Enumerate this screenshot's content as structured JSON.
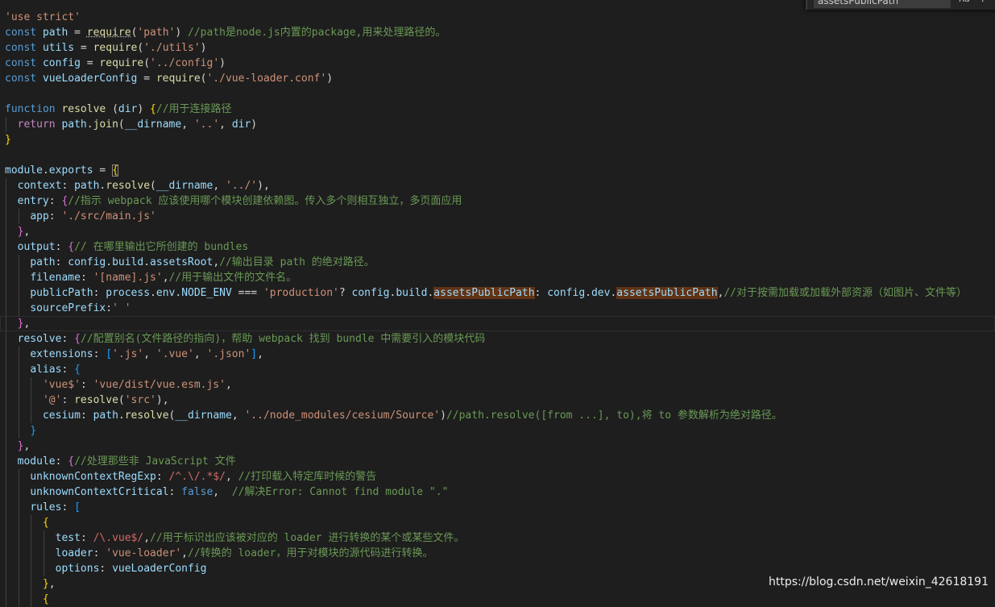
{
  "colors": {
    "background": "#1e1e1e",
    "keyword": "#569cd6",
    "control_keyword": "#c586c0",
    "string": "#ce9178",
    "variable": "#9cdcfe",
    "function": "#dcdcaa",
    "comment": "#6a9955",
    "regex": "#d16969",
    "bracket_1": "#ffd700",
    "bracket_2": "#da70d6",
    "bracket_3": "#179fff",
    "find_highlight": "#613214"
  },
  "find_widget": {
    "search_value": "assetsPublicPath",
    "icons": [
      "case-sensitive-icon",
      "regex-icon"
    ]
  },
  "watermark": "https://blog.csdn.net/weixin_42618191",
  "code_lines": [
    [
      [
        "str",
        "'use strict'"
      ]
    ],
    [
      [
        "kw",
        "const"
      ],
      [
        "pl",
        " "
      ],
      [
        "var",
        "path"
      ],
      [
        "pl",
        " = "
      ],
      [
        "fn sq",
        "require"
      ],
      [
        "pl",
        "("
      ],
      [
        "str",
        "'path'"
      ],
      [
        "pl",
        ") "
      ],
      [
        "cmt",
        "//path是node.js内置的package,用来处理路径的。"
      ]
    ],
    [
      [
        "kw",
        "const"
      ],
      [
        "pl",
        " "
      ],
      [
        "var",
        "utils"
      ],
      [
        "pl",
        " = "
      ],
      [
        "fn",
        "require"
      ],
      [
        "pl",
        "("
      ],
      [
        "str",
        "'./utils'"
      ],
      [
        "pl",
        ")"
      ]
    ],
    [
      [
        "kw",
        "const"
      ],
      [
        "pl",
        " "
      ],
      [
        "var",
        "config"
      ],
      [
        "pl",
        " = "
      ],
      [
        "fn",
        "require"
      ],
      [
        "pl",
        "("
      ],
      [
        "str",
        "'../config'"
      ],
      [
        "pl",
        ")"
      ]
    ],
    [
      [
        "kw",
        "const"
      ],
      [
        "pl",
        " "
      ],
      [
        "var",
        "vueLoaderConfig"
      ],
      [
        "pl",
        " = "
      ],
      [
        "fn",
        "require"
      ],
      [
        "pl",
        "("
      ],
      [
        "str",
        "'./vue-loader.conf'"
      ],
      [
        "pl",
        ")"
      ]
    ],
    [],
    [
      [
        "kw",
        "function"
      ],
      [
        "pl",
        " "
      ],
      [
        "fn",
        "resolve"
      ],
      [
        "pl",
        " ("
      ],
      [
        "var",
        "dir"
      ],
      [
        "pl",
        ") "
      ],
      [
        "br",
        "{"
      ],
      [
        "cmt",
        "//用于连接路径"
      ]
    ],
    [
      [
        "pl",
        "  "
      ],
      [
        "ctrl",
        "return"
      ],
      [
        "pl",
        " "
      ],
      [
        "var",
        "path"
      ],
      [
        "pl",
        "."
      ],
      [
        "fn",
        "join"
      ],
      [
        "pl",
        "("
      ],
      [
        "var",
        "__dirname"
      ],
      [
        "pl",
        ", "
      ],
      [
        "str",
        "'..'"
      ],
      [
        "pl",
        ", "
      ],
      [
        "var",
        "dir"
      ],
      [
        "pl",
        ")"
      ]
    ],
    [
      [
        "br",
        "}"
      ]
    ],
    [],
    [
      [
        "var",
        "module"
      ],
      [
        "pl",
        "."
      ],
      [
        "var",
        "exports"
      ],
      [
        "pl",
        " = "
      ],
      [
        "br bm",
        "{"
      ]
    ],
    [
      [
        "pl",
        "  "
      ],
      [
        "var",
        "context"
      ],
      [
        "pl",
        ": "
      ],
      [
        "var",
        "path"
      ],
      [
        "pl",
        "."
      ],
      [
        "fn",
        "resolve"
      ],
      [
        "pl",
        "("
      ],
      [
        "var",
        "__dirname"
      ],
      [
        "pl",
        ", "
      ],
      [
        "str",
        "'../'"
      ],
      [
        "pl",
        "),"
      ]
    ],
    [
      [
        "pl",
        "  "
      ],
      [
        "var",
        "entry"
      ],
      [
        "pl",
        ": "
      ],
      [
        "br2",
        "{"
      ],
      [
        "cmt",
        "//指示 webpack 应该使用哪个模块创建依赖图。传入多个则相互独立，多页面应用"
      ]
    ],
    [
      [
        "pl",
        "    "
      ],
      [
        "var",
        "app"
      ],
      [
        "pl",
        ": "
      ],
      [
        "str",
        "'./src/main.js'"
      ]
    ],
    [
      [
        "pl",
        "  "
      ],
      [
        "br2",
        "}"
      ],
      [
        "pl",
        ","
      ]
    ],
    [
      [
        "pl",
        "  "
      ],
      [
        "var",
        "output"
      ],
      [
        "pl",
        ": "
      ],
      [
        "br2",
        "{"
      ],
      [
        "cmt",
        "// 在哪里输出它所创建的 bundles"
      ]
    ],
    [
      [
        "pl",
        "    "
      ],
      [
        "var",
        "path"
      ],
      [
        "pl",
        ": "
      ],
      [
        "var",
        "config"
      ],
      [
        "pl",
        "."
      ],
      [
        "var",
        "build"
      ],
      [
        "pl",
        "."
      ],
      [
        "var",
        "assetsRoot"
      ],
      [
        "pl",
        ","
      ],
      [
        "cmt",
        "//输出目录 path 的绝对路径。"
      ]
    ],
    [
      [
        "pl",
        "    "
      ],
      [
        "var",
        "filename"
      ],
      [
        "pl",
        ": "
      ],
      [
        "str",
        "'[name].js'"
      ],
      [
        "pl",
        ","
      ],
      [
        "cmt",
        "//用于输出文件的文件名。"
      ]
    ],
    [
      [
        "pl",
        "    "
      ],
      [
        "var",
        "publicPath"
      ],
      [
        "pl",
        ": "
      ],
      [
        "var",
        "process"
      ],
      [
        "pl",
        "."
      ],
      [
        "var",
        "env"
      ],
      [
        "pl",
        "."
      ],
      [
        "var",
        "NODE_ENV"
      ],
      [
        "pl",
        " === "
      ],
      [
        "str",
        "'production'"
      ],
      [
        "pl",
        "? "
      ],
      [
        "var",
        "config"
      ],
      [
        "pl",
        "."
      ],
      [
        "var",
        "build"
      ],
      [
        "pl",
        "."
      ],
      [
        "var hl",
        "assetsPublicPath"
      ],
      [
        "pl",
        ": "
      ],
      [
        "var",
        "config"
      ],
      [
        "pl",
        "."
      ],
      [
        "var",
        "dev"
      ],
      [
        "pl",
        "."
      ],
      [
        "var hl",
        "assetsPublicPath"
      ],
      [
        "pl",
        ","
      ],
      [
        "cmt",
        "//对于按需加载或加载外部资源（如图片、文件等）"
      ]
    ],
    [
      [
        "pl",
        "    "
      ],
      [
        "var",
        "sourcePrefix"
      ],
      [
        "pl",
        ":"
      ],
      [
        "str",
        "' '"
      ]
    ],
    [
      [
        "pl",
        "  "
      ],
      [
        "br2",
        "}"
      ],
      [
        "pl",
        ","
      ]
    ],
    [
      [
        "pl",
        "  "
      ],
      [
        "var",
        "resolve"
      ],
      [
        "pl",
        ": "
      ],
      [
        "br2",
        "{"
      ],
      [
        "cmt",
        "//配置别名(文件路径的指向)，帮助 webpack 找到 bundle 中需要引入的模块代码"
      ]
    ],
    [
      [
        "pl",
        "    "
      ],
      [
        "var",
        "extensions"
      ],
      [
        "pl",
        ": "
      ],
      [
        "br3",
        "["
      ],
      [
        "str",
        "'.js'"
      ],
      [
        "pl",
        ", "
      ],
      [
        "str",
        "'.vue'"
      ],
      [
        "pl",
        ", "
      ],
      [
        "str",
        "'.json'"
      ],
      [
        "br3",
        "]"
      ],
      [
        "pl",
        ","
      ]
    ],
    [
      [
        "pl",
        "    "
      ],
      [
        "var",
        "alias"
      ],
      [
        "pl",
        ": "
      ],
      [
        "br3",
        "{"
      ]
    ],
    [
      [
        "pl",
        "      "
      ],
      [
        "str",
        "'vue$'"
      ],
      [
        "pl",
        ": "
      ],
      [
        "str",
        "'vue/dist/vue.esm.js'"
      ],
      [
        "pl",
        ","
      ]
    ],
    [
      [
        "pl",
        "      "
      ],
      [
        "str",
        "'@'"
      ],
      [
        "pl",
        ": "
      ],
      [
        "fn",
        "resolve"
      ],
      [
        "pl",
        "("
      ],
      [
        "str",
        "'src'"
      ],
      [
        "pl",
        "),"
      ]
    ],
    [
      [
        "pl",
        "      "
      ],
      [
        "var",
        "cesium"
      ],
      [
        "pl",
        ": "
      ],
      [
        "var",
        "path"
      ],
      [
        "pl",
        "."
      ],
      [
        "fn",
        "resolve"
      ],
      [
        "pl",
        "("
      ],
      [
        "var",
        "__dirname"
      ],
      [
        "pl",
        ", "
      ],
      [
        "str",
        "'../node_modules/cesium/Source'"
      ],
      [
        "pl",
        ")"
      ],
      [
        "cmt",
        "//path.resolve([from ...], to),将 to 参数解析为绝对路径。"
      ]
    ],
    [
      [
        "pl",
        "    "
      ],
      [
        "br3",
        "}"
      ]
    ],
    [
      [
        "pl",
        "  "
      ],
      [
        "br2",
        "}"
      ],
      [
        "pl",
        ","
      ]
    ],
    [
      [
        "pl",
        "  "
      ],
      [
        "var",
        "module"
      ],
      [
        "pl",
        ": "
      ],
      [
        "br2",
        "{"
      ],
      [
        "cmt",
        "//处理那些非 JavaScript 文件"
      ]
    ],
    [
      [
        "pl",
        "    "
      ],
      [
        "var",
        "unknownContextRegExp"
      ],
      [
        "pl",
        ": "
      ],
      [
        "rx",
        "/^.\\/.*$/"
      ],
      [
        "pl",
        ", "
      ],
      [
        "cmt",
        "//打印载入特定库时候的警告"
      ]
    ],
    [
      [
        "pl",
        "    "
      ],
      [
        "var",
        "unknownContextCritical"
      ],
      [
        "pl",
        ": "
      ],
      [
        "kw",
        "false"
      ],
      [
        "pl",
        ",  "
      ],
      [
        "cmt",
        "//解决Error: Cannot find module \".\""
      ]
    ],
    [
      [
        "pl",
        "    "
      ],
      [
        "var",
        "rules"
      ],
      [
        "pl",
        ": "
      ],
      [
        "br3",
        "["
      ]
    ],
    [
      [
        "pl",
        "      "
      ],
      [
        "br",
        "{"
      ]
    ],
    [
      [
        "pl",
        "        "
      ],
      [
        "var",
        "test"
      ],
      [
        "pl",
        ": "
      ],
      [
        "rx",
        "/\\.vue$/"
      ],
      [
        "pl",
        ","
      ],
      [
        "cmt",
        "//用于标识出应该被对应的 loader 进行转换的某个或某些文件。"
      ]
    ],
    [
      [
        "pl",
        "        "
      ],
      [
        "var",
        "loader"
      ],
      [
        "pl",
        ": "
      ],
      [
        "str",
        "'vue-loader'"
      ],
      [
        "pl",
        ","
      ],
      [
        "cmt",
        "//转换的 loader，用于对模块的源代码进行转换。"
      ]
    ],
    [
      [
        "pl",
        "        "
      ],
      [
        "var",
        "options"
      ],
      [
        "pl",
        ": "
      ],
      [
        "var",
        "vueLoaderConfig"
      ]
    ],
    [
      [
        "pl",
        "      "
      ],
      [
        "br",
        "}"
      ],
      [
        "pl",
        ","
      ]
    ],
    [
      [
        "pl",
        "      "
      ],
      [
        "br",
        "{"
      ]
    ]
  ]
}
